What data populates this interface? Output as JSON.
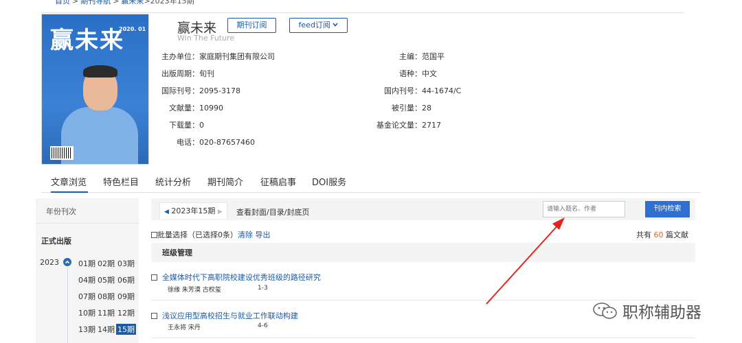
{
  "breadcrumb": {
    "items": [
      "首页",
      "期刊导航",
      "赢未来"
    ],
    "current": ">2023年15期"
  },
  "journal": {
    "cover_title": "赢未来",
    "cover_issue": "2020. 01",
    "title": "赢未来",
    "subtitle": "Win The Future",
    "subscribe_label": "期刊订阅",
    "feed_label": "feed订阅"
  },
  "info_left": [
    {
      "key": "主办单位：",
      "value": "家庭期刊集团有限公司"
    },
    {
      "key": "出版周期：",
      "value": "旬刊"
    },
    {
      "key": "国际刊号：",
      "value": "2095-3178"
    },
    {
      "key": "文献量：",
      "value": "10990"
    },
    {
      "key": "下载量：",
      "value": "0"
    },
    {
      "key": "电话：",
      "value": "020-87657460"
    }
  ],
  "info_right": [
    {
      "key": "主编：",
      "value": "范国平"
    },
    {
      "key": "语种：",
      "value": "中文"
    },
    {
      "key": "国内刊号：",
      "value": "44-1674/C"
    },
    {
      "key": "被引量：",
      "value": "28"
    },
    {
      "key": "基金论文量：",
      "value": "2717"
    }
  ],
  "tabs": [
    "文章浏览",
    "特色栏目",
    "统计分析",
    "期刊简介",
    "征稿启事",
    "DOI服务"
  ],
  "sidebar": {
    "header": "年份刊次",
    "section": "正式出版",
    "year": "2023",
    "issues": [
      [
        "01期",
        "02期",
        "03期"
      ],
      [
        "04期",
        "05期",
        "06期"
      ],
      [
        "07期",
        "08期",
        "09期"
      ],
      [
        "10期",
        "11期",
        "12期"
      ],
      [
        "13期",
        "14期",
        "15期"
      ]
    ],
    "selected": "15期"
  },
  "toolbar": {
    "current_issue": "2023年15期",
    "view_cover": "查看封面/目录/封底页",
    "search_placeholder": "请输入题名、作者",
    "search_button": "刊内检索"
  },
  "batch": {
    "label": "批量选择",
    "selected": "（已选择0条）",
    "clear": "清除",
    "export": "导出"
  },
  "total": {
    "prefix": "共有",
    "count": "60",
    "suffix": "篇文献"
  },
  "section_title": "班级管理",
  "articles": [
    {
      "title": "全媒体时代下高职院校建设优秀班级的路径研究",
      "authors": "徐缘 朱芳漠 古权玺",
      "pages": "1-3"
    },
    {
      "title": "浅议应用型高校招生与就业工作联动构建",
      "authors": "王永将 宋丹",
      "pages": "4-6"
    }
  ],
  "watermark": "职称辅助器",
  "colors": {
    "accent": "#1a5aa6",
    "button": "#2e6fd0",
    "count": "#e0641f",
    "arrow": "#e3241b"
  }
}
